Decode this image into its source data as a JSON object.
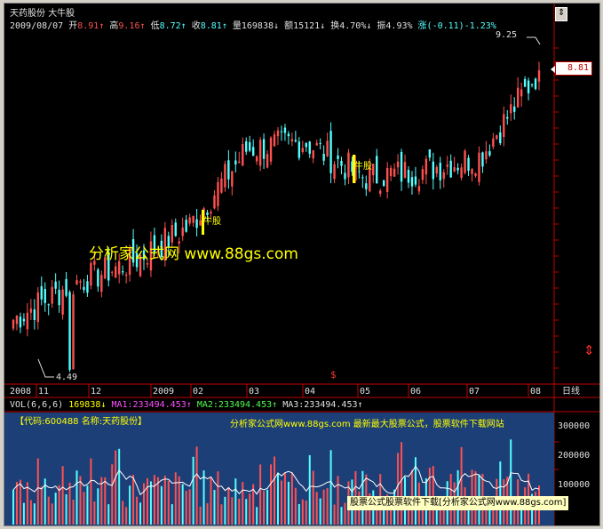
{
  "stock": {
    "name": "天药股份",
    "label": "大牛股"
  },
  "quote": {
    "date": "2009/08/07",
    "open_label": "开",
    "open": "8.91",
    "high_label": "高",
    "high": "9.16",
    "low_label": "低",
    "low": "8.72",
    "close_label": "收",
    "close": "8.81",
    "volume_label": "量",
    "volume": "169838",
    "amount_label": "额",
    "amount": "15121",
    "turnover_label": "换",
    "turnover": "4.70%",
    "amplitude_label": "振",
    "amplitude": "4.93%",
    "change_label": "涨",
    "change": "(-0.11)-1.23%"
  },
  "price_marks": {
    "max": "9.25",
    "min": "4.49",
    "current": "8.81"
  },
  "signals": [
    "牛股",
    "牛股"
  ],
  "watermark_main": "分析家公式网 www.88gs.com",
  "time_axis": {
    "labels": [
      "2008",
      "11",
      "12",
      "2009",
      "02",
      "03",
      "04",
      "05",
      "06",
      "07",
      "08"
    ],
    "period": "日线"
  },
  "vol_header": {
    "name": "VOL(6,6,6)",
    "value": "169838",
    "ma1_label": "MA1:",
    "ma1": "233494.453",
    "ma2_label": "MA2:",
    "ma2": "233494.453",
    "ma3_label": "MA3:",
    "ma3": "233494.453"
  },
  "vol_panel": {
    "code_line": "【代码:600488 名称:天药股份】",
    "ad": "分析家公式网www.88gs.com 最新最大股票公式，股票软件下载网站",
    "footer": "股票公式股票软件下载[分析家公式网www.88gs.com]",
    "bg_color": "#1c3f78"
  },
  "colors": {
    "up": "#ff5050",
    "down": "#54ffff",
    "signal": "#ffff00",
    "ma": "#ffffff"
  },
  "chart_data": [
    {
      "type": "candlestick",
      "ylim": [
        4.49,
        9.25
      ],
      "x": [
        "2008-11",
        "2008-12",
        "2009-01",
        "2009-02",
        "2009-03",
        "2009-04",
        "2009-05",
        "2009-06",
        "2009-07",
        "2009-08"
      ],
      "y_approx_close": [
        5.3,
        5.8,
        6.1,
        6.6,
        7.7,
        7.8,
        7.3,
        7.4,
        7.6,
        8.81
      ]
    },
    {
      "type": "bar",
      "ylim": [
        0,
        400000
      ],
      "y_ticks": [
        "300000",
        "200000",
        "100000"
      ]
    }
  ]
}
